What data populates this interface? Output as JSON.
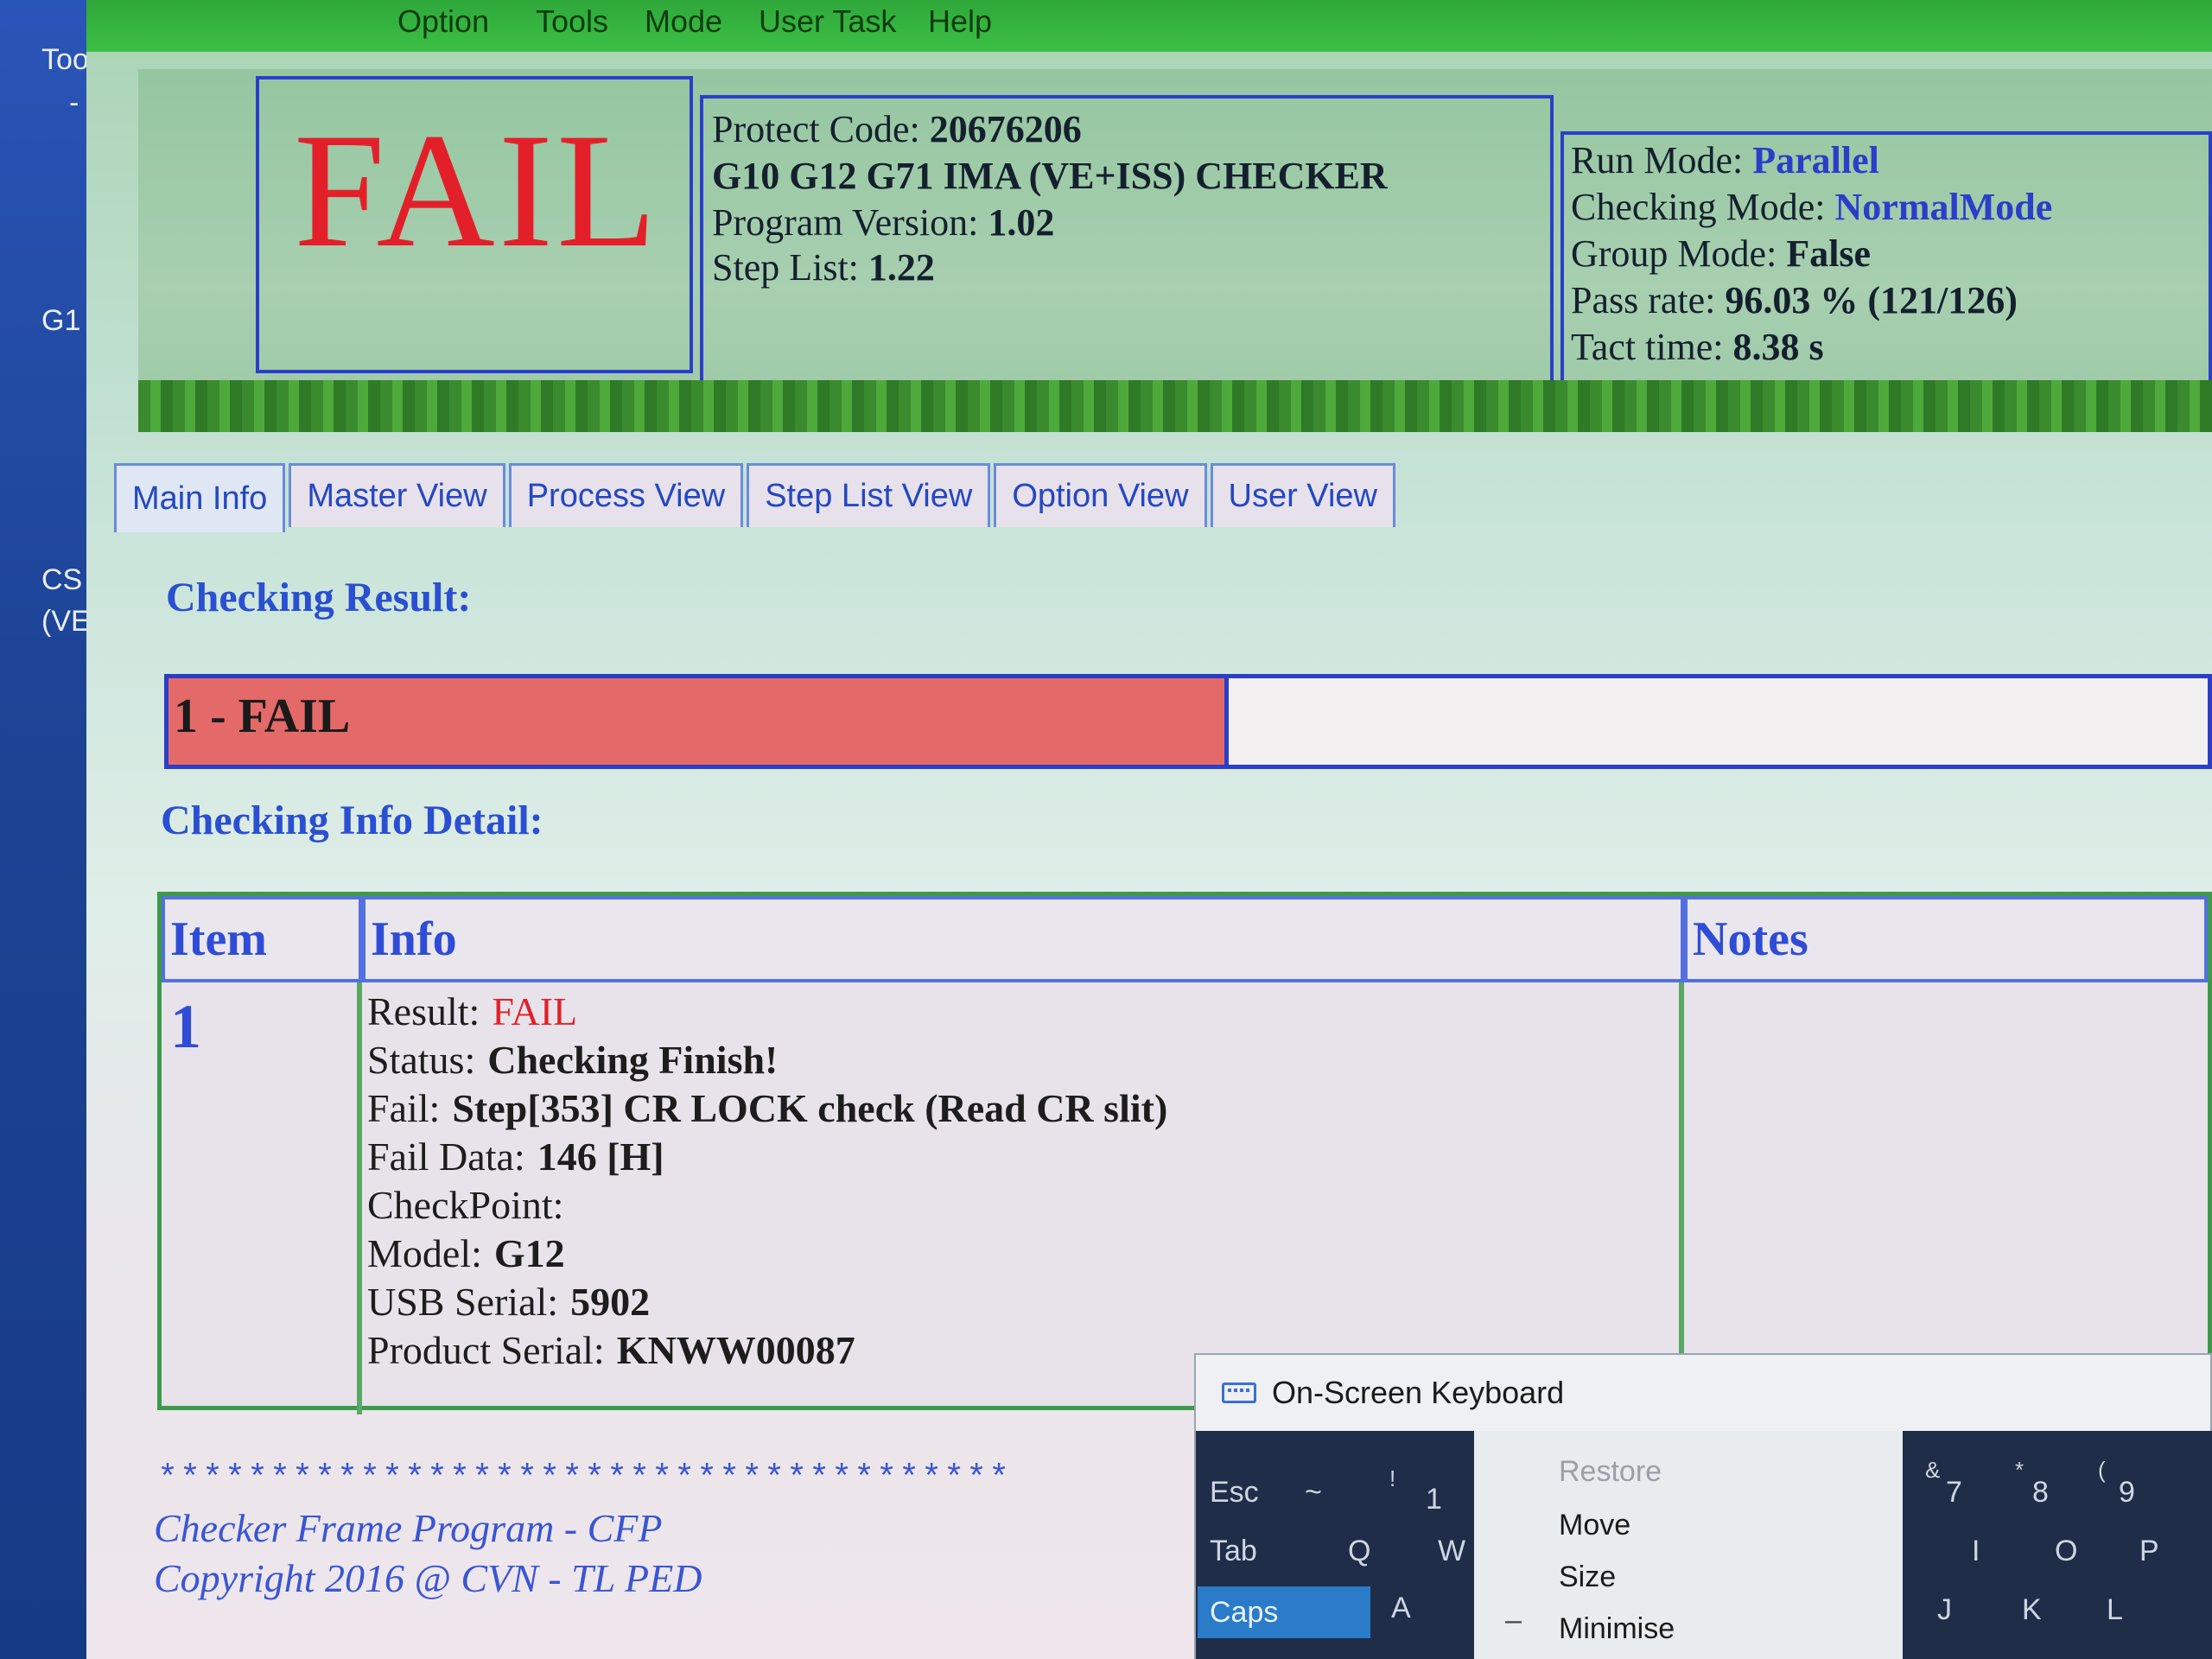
{
  "desktop": {
    "labels": [
      "Too",
      "-",
      "G1",
      "CS",
      "(VE"
    ]
  },
  "menubar": {
    "items": [
      "Option",
      "Tools",
      "Mode",
      "User Task",
      "Help"
    ]
  },
  "header": {
    "status_big": "FAIL",
    "protect_code_label": "Protect Code:",
    "protect_code_value": "20676206",
    "checker_name": "G10 G12 G71 IMA (VE+ISS) CHECKER",
    "program_version_label": "Program Version:",
    "program_version_value": "1.02",
    "step_list_label": "Step List:",
    "step_list_value": "1.22",
    "run_mode_label": "Run Mode:",
    "run_mode_value": "Parallel",
    "checking_mode_label": "Checking Mode:",
    "checking_mode_value": "NormalMode",
    "group_mode_label": "Group Mode:",
    "group_mode_value": "False",
    "pass_rate_label": "Pass rate:",
    "pass_rate_value": "96.03 % (121/126)",
    "tact_time_label": "Tact time:",
    "tact_time_value": "8.38 s"
  },
  "tabs": [
    "Main Info",
    "Master View",
    "Process View",
    "Step List View",
    "Option View",
    "User View"
  ],
  "main": {
    "checking_result_title": "Checking Result:",
    "result_text": "1 - FAIL",
    "result_progress": 0.52,
    "detail_title": "Checking Info Detail:",
    "table": {
      "headers": [
        "Item",
        "Info",
        "Notes"
      ],
      "item": "1",
      "info": [
        {
          "label": "Result:",
          "value": "FAIL"
        },
        {
          "label": "Status:",
          "value": "Checking Finish!"
        },
        {
          "label": "Fail:",
          "value": "Step[353] CR LOCK check (Read CR slit)"
        },
        {
          "label": "Fail Data:",
          "value": "146 [H]"
        },
        {
          "label": "CheckPoint:",
          "value": ""
        },
        {
          "label": "Model:",
          "value": "G12"
        },
        {
          "label": "USB Serial:",
          "value": "5902"
        },
        {
          "label": "Product Serial:",
          "value": "KNWW00087"
        }
      ]
    }
  },
  "footer": {
    "stars": "**************************************",
    "line1": "Checker Frame Program - CFP",
    "line2": "Copyright 2016 @ CVN - TL PED"
  },
  "osk": {
    "title": "On-Screen Keyboard",
    "menu": [
      "Restore",
      "Move",
      "Size",
      "Minimise"
    ],
    "keys_left": [
      "Esc",
      "~",
      "!",
      "1",
      "Tab",
      "Q",
      "W",
      "Caps",
      "A"
    ],
    "keys_right": [
      "&",
      "7",
      "*",
      "8",
      "(",
      "9",
      "I",
      "O",
      "P",
      "J",
      "K",
      "L"
    ]
  },
  "colors": {
    "fail_red": "#e3202a",
    "title_blue": "#2a4fd2",
    "border_blue": "#2a3ec9",
    "menubar_green": "#3cbf45"
  }
}
